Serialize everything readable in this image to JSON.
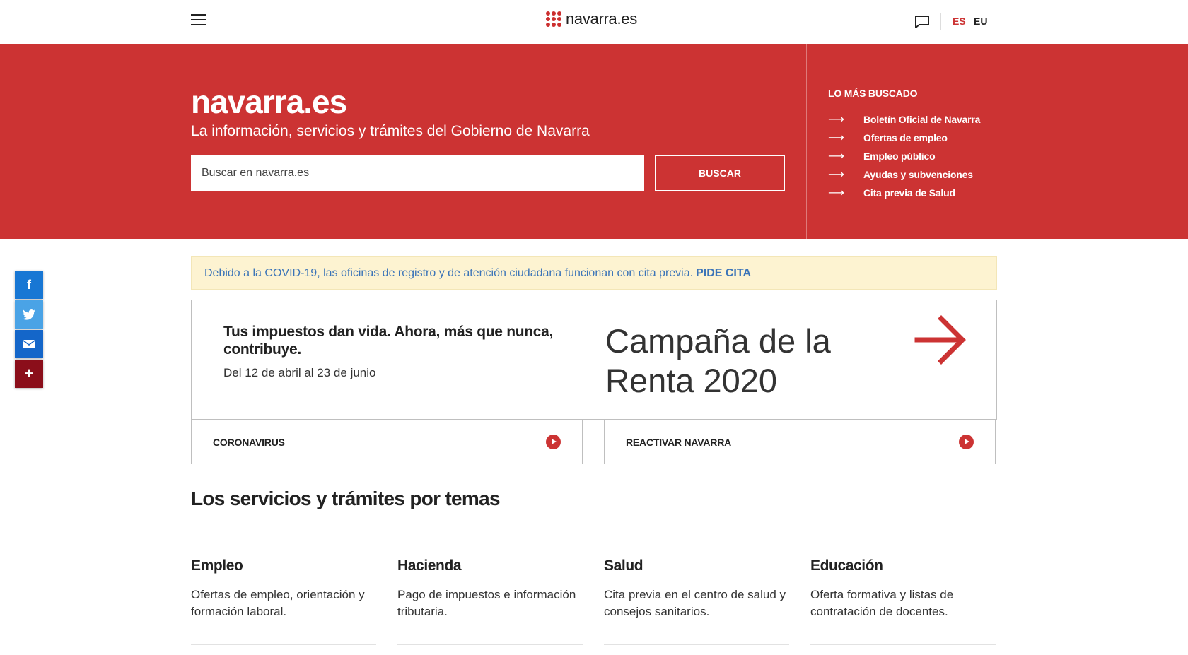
{
  "header": {
    "logo_text": "navarra.es",
    "languages": [
      {
        "code": "ES",
        "active": true
      },
      {
        "code": "EU",
        "active": false
      }
    ],
    "icons": {
      "menu": "hamburger-icon",
      "chat": "chat-icon"
    }
  },
  "hero": {
    "title": "navarra.es",
    "subtitle": "La información, servicios y trámites del Gobierno de Navarra",
    "search": {
      "placeholder": "Buscar en navarra.es",
      "value": "",
      "button_label": "BUSCAR"
    },
    "most_searched": {
      "title": "LO MÁS BUSCADO",
      "items": [
        {
          "label": "Boletín Oficial de Navarra"
        },
        {
          "label": "Ofertas de empleo"
        },
        {
          "label": "Empleo público"
        },
        {
          "label": "Ayudas y subvenciones"
        },
        {
          "label": "Cita previa de Salud"
        }
      ]
    }
  },
  "social": [
    {
      "name": "facebook",
      "icon": "f",
      "color": "#1877d4"
    },
    {
      "name": "twitter",
      "icon": "t",
      "color": "#4aa3e6"
    },
    {
      "name": "email",
      "icon": "✉",
      "color": "#1466c9"
    },
    {
      "name": "more",
      "icon": "+",
      "color": "#8b0e1a"
    }
  ],
  "notice": {
    "text": "Debido a la COVID-19, las oficinas de registro y de atención ciudadana funcionan con cita previa.",
    "link": "PIDE CITA"
  },
  "campaign": {
    "headline": "Tus impuestos dan vida. Ahora, más que nunca, contribuye.",
    "dates": "Del 12 de abril al 23 de junio",
    "title": "Campaña de la Renta 2020"
  },
  "quick_links": [
    {
      "label": "CORONAVIRUS"
    },
    {
      "label": "REACTIVAR NAVARRA"
    }
  ],
  "topics_section": {
    "title": "Los servicios y trámites por temas",
    "items": [
      {
        "name": "Empleo",
        "description": "Ofertas de empleo, orientación y formación laboral."
      },
      {
        "name": "Hacienda",
        "description": "Pago de impuestos e información tributaria."
      },
      {
        "name": "Salud",
        "description": "Cita previa en el centro de salud y consejos sanitarios."
      },
      {
        "name": "Educación",
        "description": "Oferta formativa y listas de contratación de docentes."
      }
    ]
  },
  "colors": {
    "brand_red": "#cc3333",
    "notice_bg": "#fdf3d1",
    "link_blue": "#3b74b8"
  }
}
